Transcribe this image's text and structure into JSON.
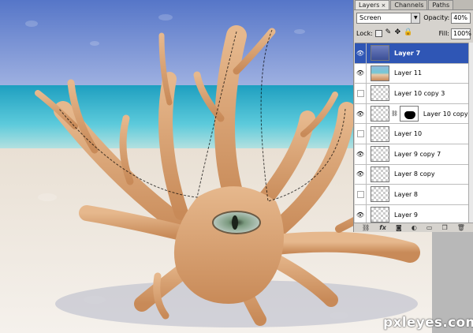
{
  "panel": {
    "tabs": [
      {
        "label": "Layers",
        "close": "×"
      },
      {
        "label": "Channels"
      },
      {
        "label": "Paths"
      }
    ],
    "blend_mode": "Screen",
    "opacity_label": "Opacity:",
    "opacity_value": "40%",
    "lock_label": "Lock:",
    "fill_label": "Fill:",
    "fill_value": "100%",
    "layers": [
      {
        "name": "Layer 7",
        "visible": true,
        "selected": true,
        "thumb": "blue"
      },
      {
        "name": "Layer 11",
        "visible": true,
        "thumb": "beach"
      },
      {
        "name": "Layer 10 copy 3",
        "visible": false,
        "thumb": "checker"
      },
      {
        "name": "Layer 10 copy",
        "visible": true,
        "thumb": "checker",
        "mask": true
      },
      {
        "name": "Layer 10",
        "visible": false,
        "thumb": "checker"
      },
      {
        "name": "Layer 9 copy 7",
        "visible": true,
        "thumb": "checker"
      },
      {
        "name": "Layer 8 copy",
        "visible": true,
        "thumb": "checker"
      },
      {
        "name": "Layer 8",
        "visible": false,
        "thumb": "checker"
      },
      {
        "name": "Layer 9",
        "visible": true,
        "thumb": "checker"
      }
    ],
    "footer_icons": [
      "link-icon",
      "fx-icon",
      "mask-icon",
      "adjustment-icon",
      "folder-icon",
      "new-layer-icon",
      "trash-icon"
    ]
  },
  "watermark": "pxleyes.com",
  "colors": {
    "selected_layer": "#2f56b5",
    "panel_bg": "#d6d3ce",
    "sky": "#5f7fcf",
    "sea": "#33b7cf",
    "sand": "#eee6dc",
    "starfish": "#d9a070"
  }
}
